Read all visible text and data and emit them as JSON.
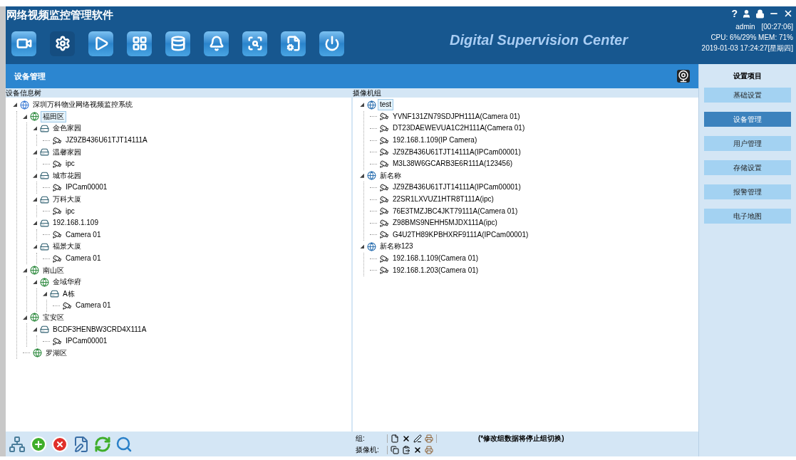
{
  "window": {
    "title": "网络视频监控管理软件",
    "brand": "Digital Supervision Center",
    "help": "?"
  },
  "toolbar": [
    {
      "selected": false
    },
    {
      "selected": true
    },
    {
      "selected": false
    },
    {
      "selected": false
    },
    {
      "selected": false
    },
    {
      "selected": false
    },
    {
      "selected": false
    },
    {
      "selected": false
    },
    {
      "selected": false
    }
  ],
  "status": {
    "user": "admin",
    "uptime": "[00:27:06]",
    "cpu": "CPU:  6%/29%  MEM: 71%",
    "datetime": "2019-01-03 17:24:27[星期四]"
  },
  "section_title": "设备管理",
  "device_tree": {
    "title": "设备信息树",
    "nodes": [
      {
        "kind": "root",
        "label": "深圳万科物业网络视频监控系统",
        "selected": false,
        "expanded": true,
        "children": [
          {
            "kind": "area",
            "label": "福田区",
            "selected": true,
            "expanded": true,
            "children": [
              {
                "kind": "device",
                "label": "金色家园",
                "selected": false,
                "expanded": true,
                "children": [
                  {
                    "kind": "camera",
                    "label": "JZ9ZB436U61TJT14111A",
                    "selected": false
                  }
                ]
              },
              {
                "kind": "device",
                "label": "温馨家园",
                "selected": false,
                "expanded": true,
                "children": [
                  {
                    "kind": "camera",
                    "label": "ipc",
                    "selected": false
                  }
                ]
              },
              {
                "kind": "device",
                "label": "城市花园",
                "selected": false,
                "expanded": true,
                "children": [
                  {
                    "kind": "camera",
                    "label": "IPCam00001",
                    "selected": false
                  }
                ]
              },
              {
                "kind": "device",
                "label": "万科大厦",
                "selected": false,
                "expanded": true,
                "children": [
                  {
                    "kind": "camera",
                    "label": "ipc",
                    "selected": false
                  }
                ]
              },
              {
                "kind": "device",
                "label": "192.168.1.109",
                "selected": false,
                "expanded": true,
                "children": [
                  {
                    "kind": "camera",
                    "label": "Camera 01",
                    "selected": false
                  }
                ]
              },
              {
                "kind": "device",
                "label": "福景大厦",
                "selected": false,
                "expanded": true,
                "children": [
                  {
                    "kind": "camera",
                    "label": "Camera 01",
                    "selected": false
                  }
                ]
              }
            ]
          },
          {
            "kind": "area",
            "label": "南山区",
            "selected": false,
            "expanded": true,
            "children": [
              {
                "kind": "area",
                "label": "金域华府",
                "selected": false,
                "expanded": true,
                "children": [
                  {
                    "kind": "device",
                    "label": "A栋",
                    "selected": false,
                    "expanded": true,
                    "children": [
                      {
                        "kind": "camera",
                        "label": "Camera 01",
                        "selected": false
                      }
                    ]
                  }
                ]
              }
            ]
          },
          {
            "kind": "area",
            "label": "宝安区",
            "selected": false,
            "expanded": true,
            "children": [
              {
                "kind": "device",
                "label": "BCDF3HENBW3CRD4X111A",
                "selected": false,
                "expanded": true,
                "children": [
                  {
                    "kind": "camera",
                    "label": "IPCam00001",
                    "selected": false
                  }
                ]
              }
            ]
          },
          {
            "kind": "area",
            "label": "罗湖区",
            "selected": false
          }
        ]
      }
    ]
  },
  "camera_groups": {
    "title": "摄像机组",
    "nodes": [
      {
        "kind": "group",
        "label": "test",
        "selected": true,
        "expanded": true,
        "children": [
          {
            "kind": "camera",
            "label": "YVNF131ZN79SDJPH111A(Camera 01)",
            "selected": false
          },
          {
            "kind": "camera",
            "label": "DT23DAEWEVUA1C2H111A(Camera 01)",
            "selected": false
          },
          {
            "kind": "camera",
            "label": "192.168.1.109(IP Camera)",
            "selected": false
          },
          {
            "kind": "camera",
            "label": "JZ9ZB436U61TJT14111A(IPCam00001)",
            "selected": false
          },
          {
            "kind": "camera",
            "label": "M3L38W6GCARB3E6R111A(123456)",
            "selected": false
          }
        ]
      },
      {
        "kind": "group",
        "label": "新名称",
        "selected": false,
        "expanded": true,
        "children": [
          {
            "kind": "camera",
            "label": "JZ9ZB436U61TJT14111A(IPCam00001)",
            "selected": false
          },
          {
            "kind": "camera",
            "label": "22SR1LXVUZ1HTR8T111A(ipc)",
            "selected": false
          },
          {
            "kind": "camera",
            "label": "76E3TMZJBC4JKT79111A(Camera 01)",
            "selected": false
          },
          {
            "kind": "camera",
            "label": "Z98BMS9NEHH5MJDX111A(ipc)",
            "selected": false
          },
          {
            "kind": "camera",
            "label": "G4U2TH89KPBHXRF9111A(IPCam00001)",
            "selected": false
          }
        ]
      },
      {
        "kind": "group",
        "label": "新名称123",
        "selected": false,
        "expanded": true,
        "children": [
          {
            "kind": "camera",
            "label": "192.168.1.109(Camera 01)",
            "selected": false
          },
          {
            "kind": "camera",
            "label": "192.168.1.203(Camera 01)",
            "selected": false
          }
        ]
      }
    ]
  },
  "group_toolbar": {
    "group_label": "组:",
    "note": "(*修改组数据将停止组切换)",
    "camera_label": "摄像机:"
  },
  "settings": {
    "title": "设置项目",
    "items": [
      {
        "label": "基础设置",
        "selected": false
      },
      {
        "label": "设备管理",
        "selected": true
      },
      {
        "label": "用户管理",
        "selected": false
      },
      {
        "label": "存储设置",
        "selected": false
      },
      {
        "label": "报警管理",
        "selected": false
      },
      {
        "label": "电子地图",
        "selected": false
      }
    ]
  }
}
